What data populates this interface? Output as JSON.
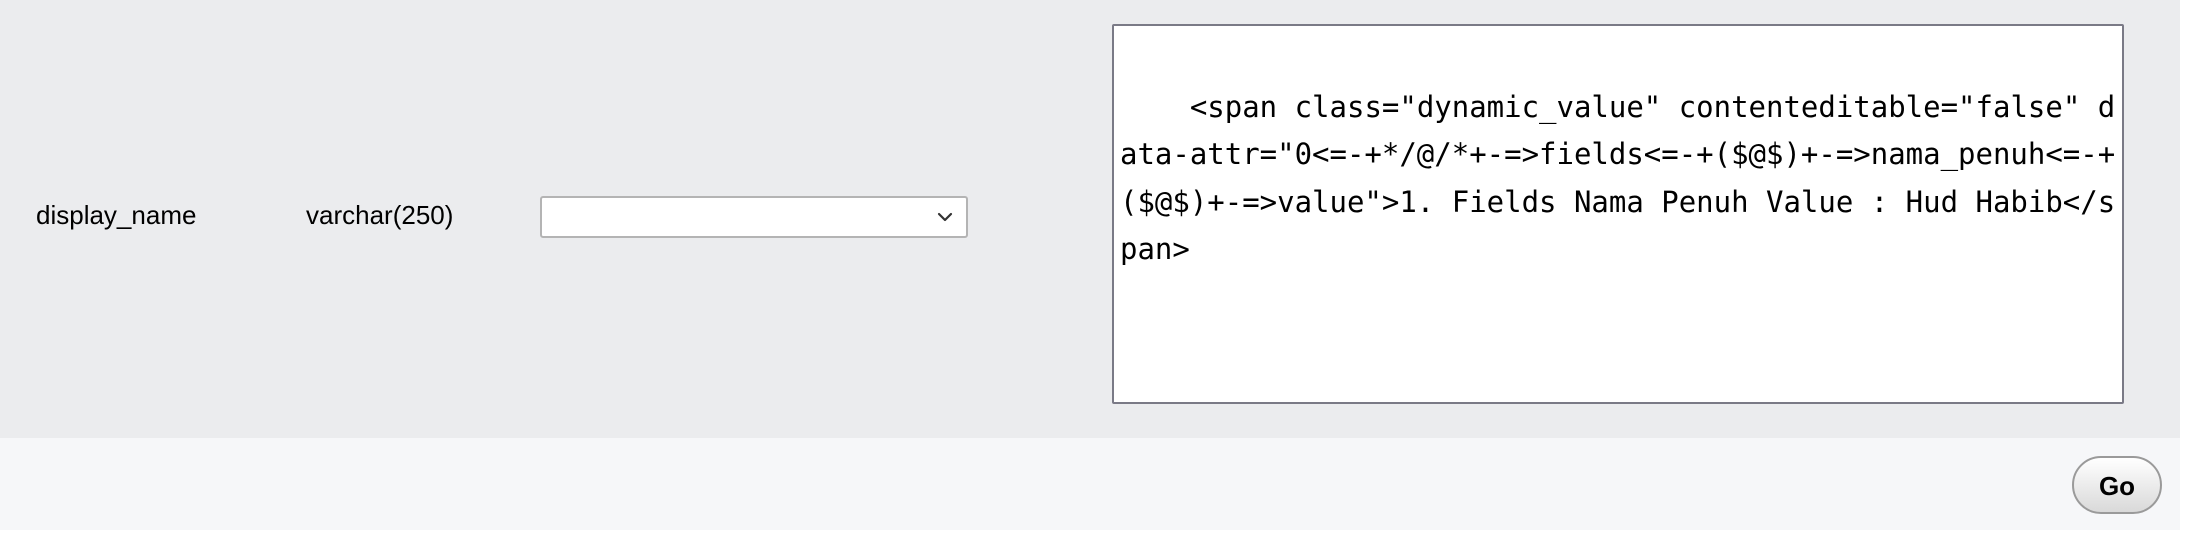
{
  "field": {
    "name": "display_name",
    "type": "varchar(250)",
    "function_select": {
      "selected": "",
      "icon": "chevron-down-icon"
    },
    "value": "<span class=\"dynamic_value\" contenteditable=\"false\" data-attr=\"0<=-+*/@/*+-=>fields<=-+($@$)+-=>nama_penuh<=-+($@$)+-=>value\">1. Fields Nama Penuh Value : Hud Habib</span>"
  },
  "footer": {
    "go_label": "Go"
  },
  "colors": {
    "row_background": "#ebecee",
    "footer_background": "#f6f7f9",
    "textarea_border": "#7a7a86"
  }
}
